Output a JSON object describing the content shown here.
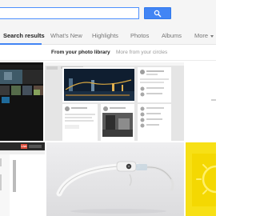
{
  "search": {
    "value": "",
    "placeholder": ""
  },
  "tabs": [
    {
      "label": "Search results",
      "active": true
    },
    {
      "label": "What's New",
      "active": false
    },
    {
      "label": "Highlights",
      "active": false
    },
    {
      "label": "Photos",
      "active": false
    },
    {
      "label": "Albums",
      "active": false
    },
    {
      "label": "More",
      "active": false
    }
  ],
  "subtabs": [
    {
      "label": "From your photo library",
      "active": true
    },
    {
      "label": "More from your circles",
      "active": false
    }
  ],
  "thumbnail_badge": "Live",
  "colors": {
    "accent": "#4285f4",
    "tab_inactive": "#777777",
    "tab_active": "#222222",
    "sun_yellow": "#f7e016"
  }
}
